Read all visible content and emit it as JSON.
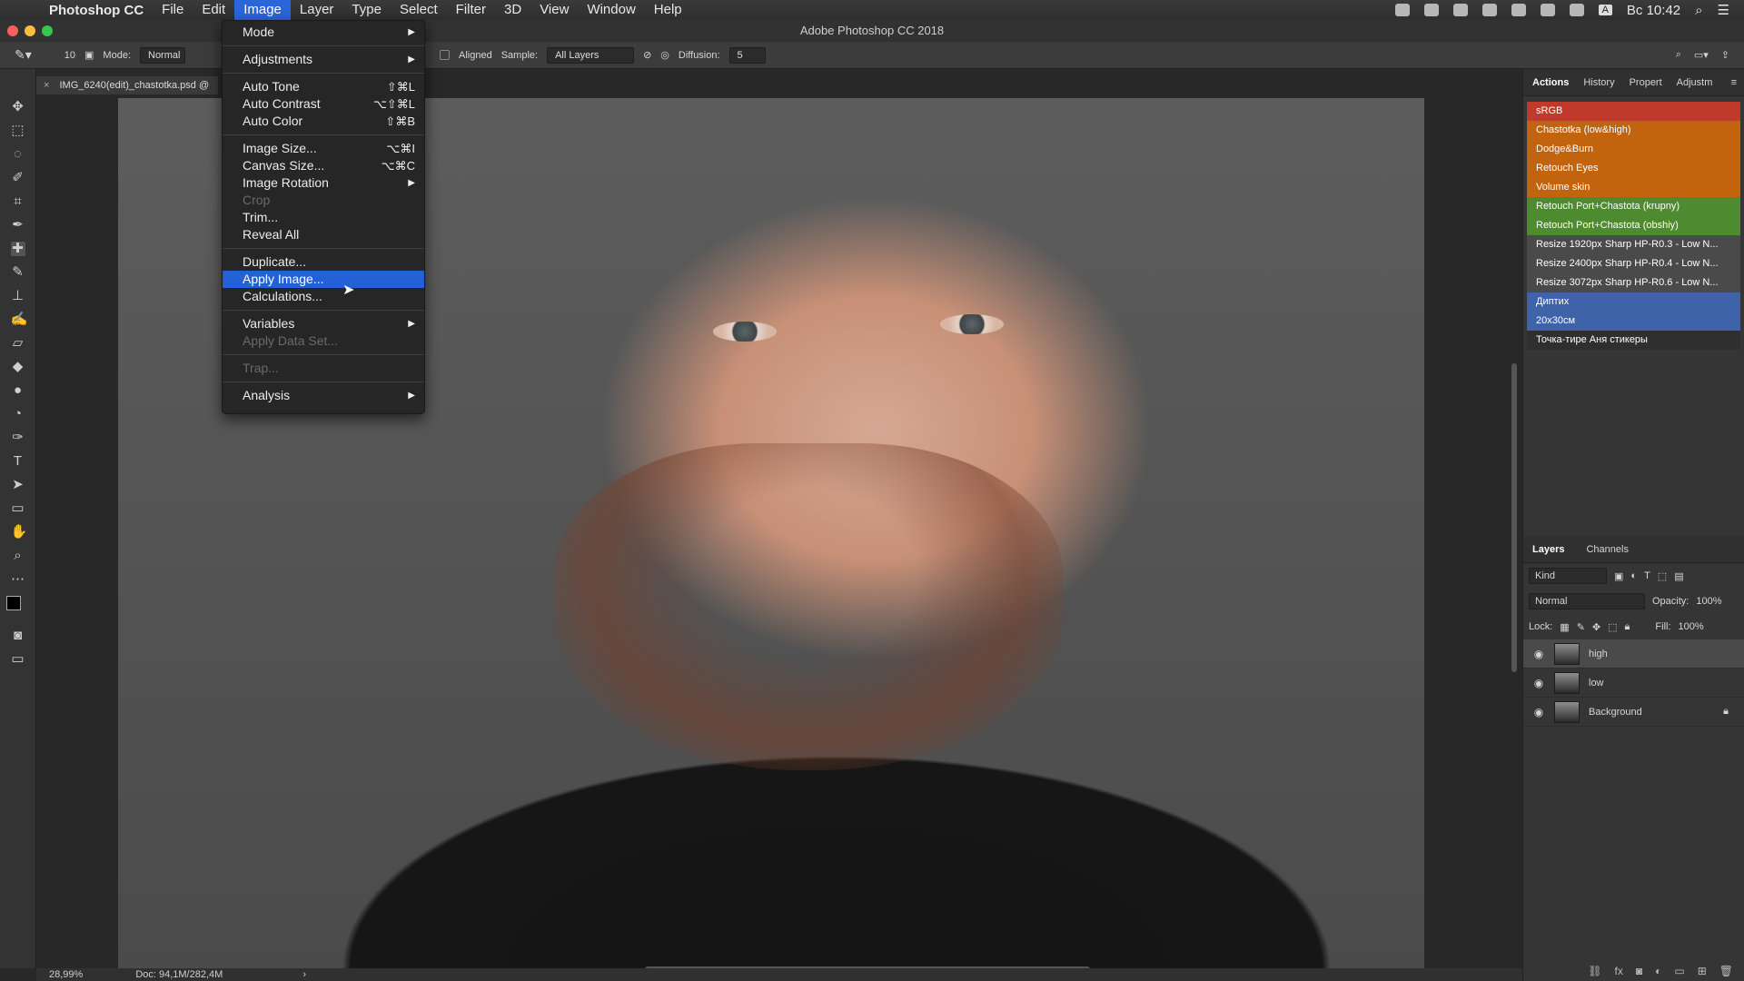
{
  "menubar": {
    "app_name": "Photoshop CC",
    "menus": [
      "File",
      "Edit",
      "Image",
      "Layer",
      "Type",
      "Select",
      "Filter",
      "3D",
      "View",
      "Window",
      "Help"
    ],
    "active_menu": "Image",
    "clock": "Вс 10:42",
    "input_source": "A"
  },
  "window": {
    "title": "Adobe Photoshop CC 2018"
  },
  "options_bar": {
    "brush_size": "10",
    "mode_label": "Mode:",
    "mode_value": "Normal",
    "aligned_label": "Aligned",
    "sample_label": "Sample:",
    "sample_value": "All Layers",
    "diffusion_label": "Diffusion:",
    "diffusion_value": "5"
  },
  "document_tab": {
    "name": "IMG_6240(edit)_chastotka.psd @"
  },
  "status_bar": {
    "zoom": "28,99%",
    "doc_size": "Doc: 94,1M/282,4M"
  },
  "image_menu": [
    {
      "label": "Mode",
      "arrow": true
    },
    {
      "sep": true
    },
    {
      "label": "Adjustments",
      "arrow": true
    },
    {
      "sep": true
    },
    {
      "label": "Auto Tone",
      "shortcut": "⇧⌘L"
    },
    {
      "label": "Auto Contrast",
      "shortcut": "⌥⇧⌘L"
    },
    {
      "label": "Auto Color",
      "shortcut": "⇧⌘B"
    },
    {
      "sep": true
    },
    {
      "label": "Image Size...",
      "shortcut": "⌥⌘I"
    },
    {
      "label": "Canvas Size...",
      "shortcut": "⌥⌘C"
    },
    {
      "label": "Image Rotation",
      "arrow": true
    },
    {
      "label": "Crop",
      "disabled": true
    },
    {
      "label": "Trim..."
    },
    {
      "label": "Reveal All"
    },
    {
      "sep": true
    },
    {
      "label": "Duplicate..."
    },
    {
      "label": "Apply Image...",
      "highlight": true
    },
    {
      "label": "Calculations..."
    },
    {
      "sep": true
    },
    {
      "label": "Variables",
      "arrow": true
    },
    {
      "label": "Apply Data Set...",
      "disabled": true
    },
    {
      "sep": true
    },
    {
      "label": "Trap...",
      "disabled": true
    },
    {
      "sep": true
    },
    {
      "label": "Analysis",
      "arrow": true
    }
  ],
  "actions_panel": {
    "tabs": [
      "Actions",
      "History",
      "Propert",
      "Adjustm"
    ],
    "active_tab": "Actions",
    "items": [
      {
        "label": "sRGB",
        "color": "#c0392b"
      },
      {
        "label": "Chastotka (low&high)",
        "color": "#c2630d"
      },
      {
        "label": "Dodge&Burn",
        "color": "#c2630d"
      },
      {
        "label": "Retouch Eyes",
        "color": "#c2630d"
      },
      {
        "label": "Volume skin",
        "color": "#c2630d"
      },
      {
        "label": "Retouch Port+Chastota (krupny)",
        "color": "#4e8a2f"
      },
      {
        "label": "Retouch Port+Chastota (obshiy)",
        "color": "#4e8a2f"
      },
      {
        "label": "Resize 1920px Sharp HP-R0.3 - Low N...",
        "color": "#4a4a4a"
      },
      {
        "label": "Resize 2400px Sharp HP-R0.4 - Low N...",
        "color": "#4a4a4a"
      },
      {
        "label": "Resize 3072px Sharp HP-R0.6 - Low N...",
        "color": "#4a4a4a"
      },
      {
        "label": "Диптих",
        "color": "#3f63a8"
      },
      {
        "label": "20x30см",
        "color": "#3f63a8"
      },
      {
        "label": "Точка-тире Аня стикеры",
        "color": "#2f2f2f"
      }
    ]
  },
  "layers_panel": {
    "tabs": [
      "Layers",
      "Channels"
    ],
    "kind_label": "Kind",
    "blend_mode": "Normal",
    "opacity_label": "Opacity:",
    "opacity_value": "100%",
    "lock_label": "Lock:",
    "fill_label": "Fill:",
    "fill_value": "100%",
    "layers": [
      {
        "name": "high",
        "selected": true
      },
      {
        "name": "low"
      },
      {
        "name": "Background",
        "locked": true
      }
    ]
  },
  "icons": {
    "tools": [
      "move-icon",
      "marquee-icon",
      "lasso-icon",
      "quick-select-icon",
      "crop-icon",
      "eyedropper-icon",
      "healing-brush-icon",
      "brush-icon",
      "stamp-icon",
      "history-brush-icon",
      "eraser-icon",
      "paint-bucket-icon",
      "blur-icon",
      "dodge-icon",
      "pen-icon",
      "type-icon",
      "path-select-icon",
      "shape-icon",
      "hand-icon",
      "zoom-icon",
      "more-icon"
    ]
  }
}
